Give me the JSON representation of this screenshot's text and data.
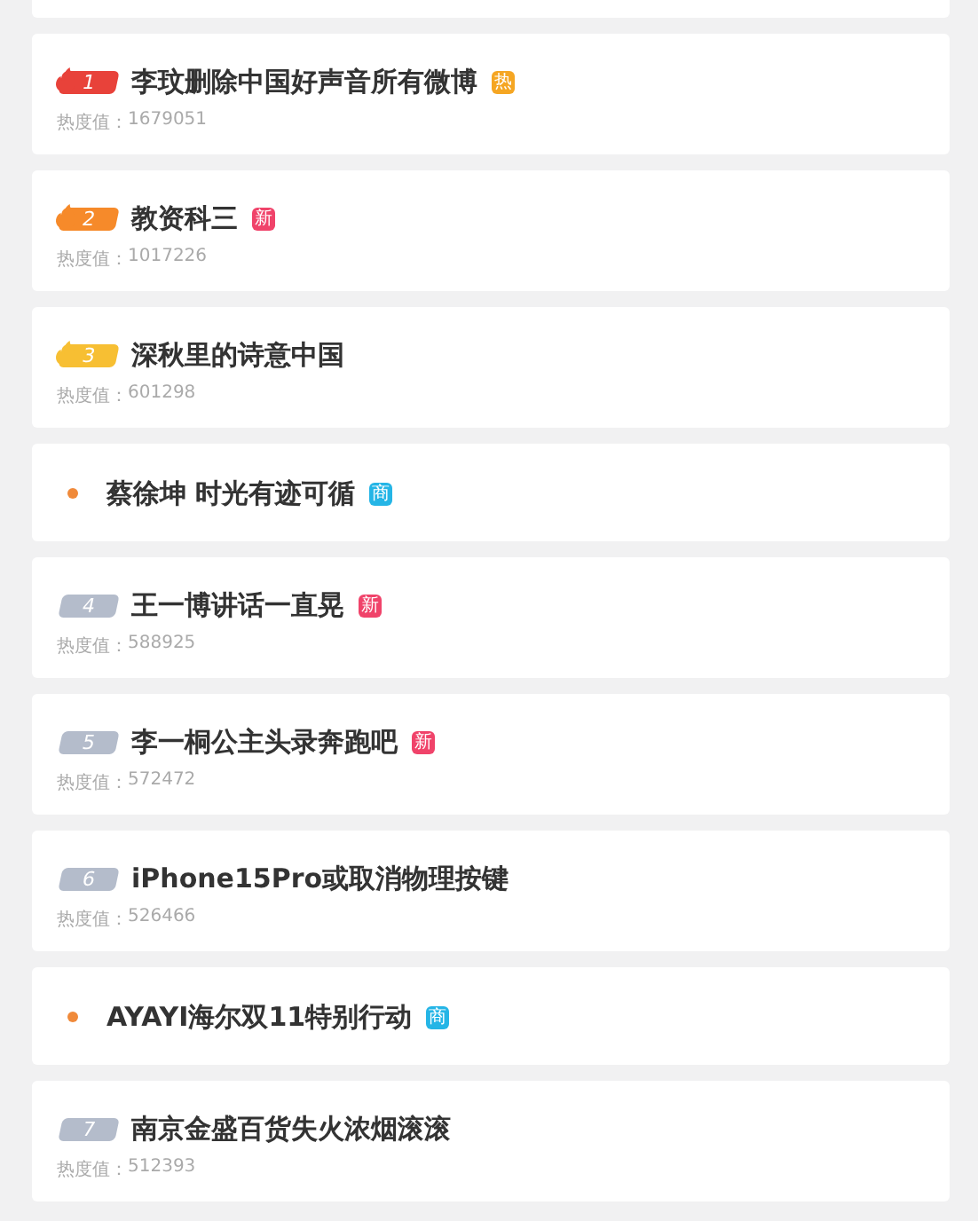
{
  "items": [
    {
      "kind": "top",
      "rank": {
        "text": "1",
        "color": "#e8423a"
      },
      "title": "李玟删除中国好声音所有微博",
      "tag": {
        "text": "热",
        "color": "#f5a623"
      },
      "heat_label": "热度值：",
      "heat": "1679051"
    },
    {
      "kind": "top",
      "rank": {
        "text": "2",
        "color": "#f68a2a"
      },
      "title": "教资科三",
      "tag": {
        "text": "新",
        "color": "#f0436a"
      },
      "heat_label": "热度值：",
      "heat": "1017226"
    },
    {
      "kind": "top",
      "rank": {
        "text": "3",
        "color": "#f7bf33"
      },
      "title": "深秋里的诗意中国",
      "heat_label": "热度值：",
      "heat": "601298"
    },
    {
      "kind": "ad",
      "title": "蔡徐坤 时光有迹可循",
      "tag": {
        "text": "商",
        "color": "#25b5e6"
      }
    },
    {
      "kind": "ranked",
      "rank": {
        "text": "4",
        "color": "#b4bccb"
      },
      "title": "王一博讲话一直晃",
      "tag": {
        "text": "新",
        "color": "#f0436a"
      },
      "heat_label": "热度值：",
      "heat": "588925"
    },
    {
      "kind": "ranked",
      "rank": {
        "text": "5",
        "color": "#b4bccb"
      },
      "title": "李一桐公主头录奔跑吧",
      "tag": {
        "text": "新",
        "color": "#f0436a"
      },
      "heat_label": "热度值：",
      "heat": "572472"
    },
    {
      "kind": "ranked",
      "rank": {
        "text": "6",
        "color": "#b4bccb"
      },
      "title": "iPhone15Pro或取消物理按键",
      "heat_label": "热度值：",
      "heat": "526466"
    },
    {
      "kind": "ad",
      "title": "AYAYI海尔双11特别行动",
      "tag": {
        "text": "商",
        "color": "#25b5e6"
      }
    },
    {
      "kind": "ranked",
      "rank": {
        "text": "7",
        "color": "#b4bccb"
      },
      "title": "南京金盛百货失火浓烟滚滚",
      "heat_label": "热度值：",
      "heat": "512393"
    }
  ]
}
